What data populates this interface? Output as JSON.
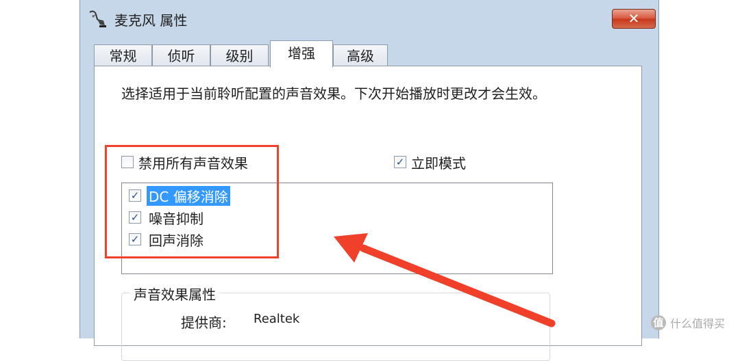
{
  "window": {
    "title": "麦克风 属性",
    "close_label": "✕",
    "icon": "microphone-icon"
  },
  "tabs": [
    {
      "label": "常规",
      "active": false
    },
    {
      "label": "侦听",
      "active": false
    },
    {
      "label": "级别",
      "active": false
    },
    {
      "label": "增强",
      "active": true
    },
    {
      "label": "高级",
      "active": false
    }
  ],
  "panel": {
    "description": "选择适用于当前聆听配置的声音效果。下次开始播放时更改才会生效。",
    "disable_all": {
      "label": "禁用所有声音效果",
      "checked": false
    },
    "immediate_mode": {
      "label": "立即模式",
      "checked": true
    },
    "effects": [
      {
        "label": "DC 偏移消除",
        "checked": true,
        "selected": true
      },
      {
        "label": "噪音抑制",
        "checked": true,
        "selected": false
      },
      {
        "label": "回声消除",
        "checked": true,
        "selected": false
      }
    ],
    "properties_group": {
      "title": "声音效果属性",
      "provider_label": "提供商:",
      "provider_value": "Realtek"
    }
  },
  "watermark": {
    "text": "什么值得买",
    "icon": "smzdm-logo-icon"
  },
  "colors": {
    "highlight_box": "#f0402a",
    "selection": "#3399ff"
  }
}
